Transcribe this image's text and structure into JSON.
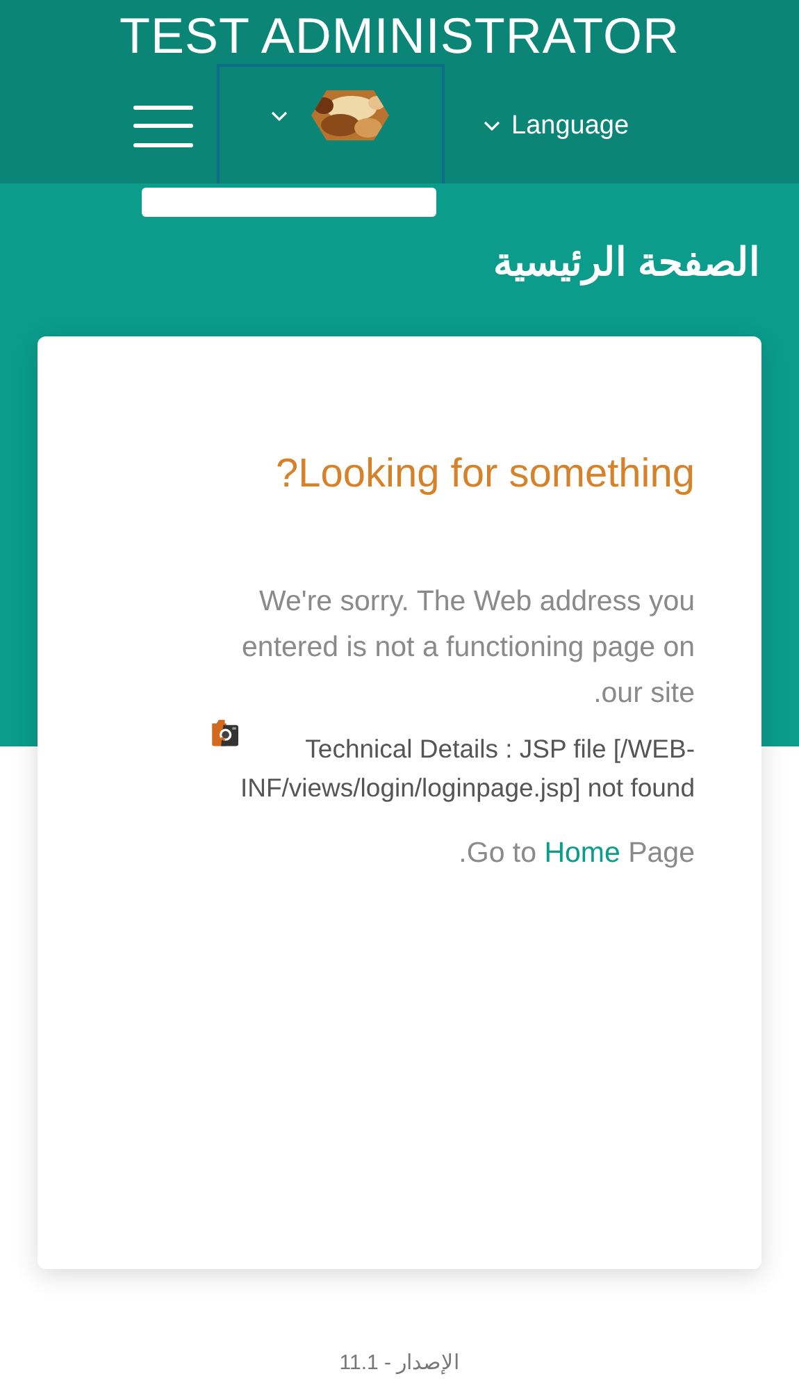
{
  "header": {
    "title": "TEST ADMINISTRATOR"
  },
  "nav": {
    "language_menu": {
      "label": "Language"
    }
  },
  "page_heading": "الصفحة الرئيسية",
  "error_card": {
    "title": "Looking for something?",
    "message": "We're sorry. The Web address you entered is not a functioning page on our site.",
    "details": "Technical Details : JSP file [/WEB-INF/views/login/loginpage.jsp] not found",
    "link_line": {
      "before": ".Go to",
      "link": "Home",
      "after": "Page"
    }
  },
  "footer": {
    "version": "الإصدار - 11.1"
  }
}
